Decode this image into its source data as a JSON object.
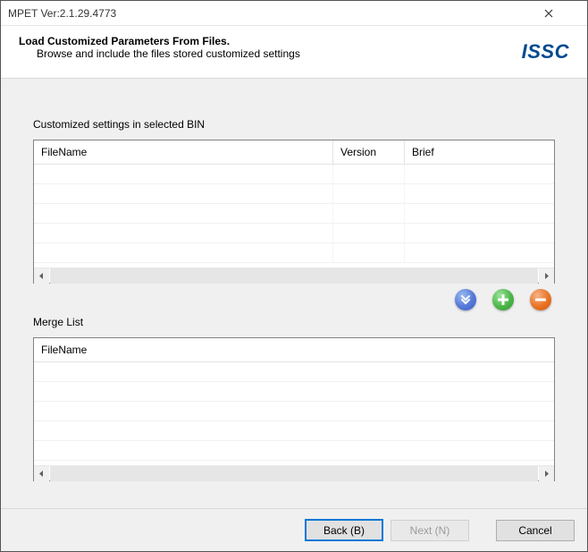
{
  "title": "MPET Ver:2.1.29.4773",
  "header": {
    "title": "Load Customized Parameters From Files.",
    "subtitle": "Browse and include the files stored customized settings"
  },
  "logo": "ISSC",
  "sections": {
    "top_label": "Customized settings in selected BIN",
    "bottom_label": "Merge List"
  },
  "grid_top": {
    "columns": {
      "filename": "FileName",
      "version": "Version",
      "brief": "Brief"
    }
  },
  "grid_bottom": {
    "columns": {
      "filename": "FileName"
    }
  },
  "buttons": {
    "back": "Back (B)",
    "next": "Next (N)",
    "cancel": "Cancel"
  },
  "icons": {
    "down": "down-arrows",
    "add": "plus",
    "remove": "minus"
  }
}
